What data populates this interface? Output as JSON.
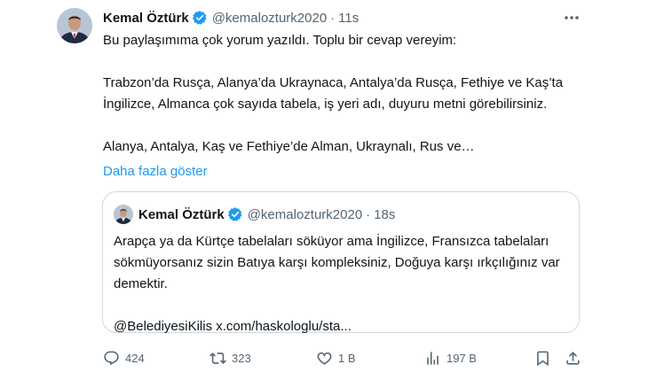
{
  "tweet": {
    "author_name": "Kemal Öztürk",
    "author_handle": "@kemalozturk2020",
    "separator": "·",
    "time": "11s",
    "body": "Bu paylaşımıma çok yorum yazıldı.  Toplu bir cevap vereyim:\n\nTrabzon’da Rusça, Alanya’da Ukraynaca, Antalya’da Rusça, Fethiye ve Kaş’ta İngilizce, Almanca çok sayıda tabela, iş yeri adı, duyuru metni görebilirsiniz.\n\nAlanya, Antalya, Kaş ve Fethiye’de Alman, Ukraynalı, Rus ve…",
    "show_more": "Daha fazla göster"
  },
  "quote": {
    "author_name": "Kemal Öztürk",
    "author_handle": "@kemalozturk2020",
    "separator": "·",
    "time": "18s",
    "body": "Arapça ya da Kürtçe tabelaları söküyor ama İngilizce, Fransızca tabelaları sökmüyorsanız sizin Batıya karşı kompleksiniz, Doğuya karşı ırkçılığınız var demektir.\n\n@BelediyesiKilis x.com/haskologlu/sta..."
  },
  "actions": {
    "replies": "424",
    "retweets": "323",
    "likes": "1 B",
    "views": "197 B"
  },
  "icons": {
    "verified": "verified-badge-icon",
    "more": "more-options-icon",
    "reply": "reply-icon",
    "retweet": "retweet-icon",
    "like": "heart-icon",
    "views": "views-chart-icon",
    "bookmark": "bookmark-icon",
    "share": "share-icon"
  },
  "colors": {
    "link": "#1d9bf0",
    "verified": "#1d9bf0",
    "secondary_text": "#536471",
    "border": "#cfd9de"
  }
}
